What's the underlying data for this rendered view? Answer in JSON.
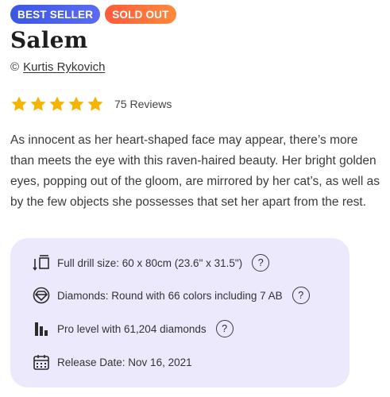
{
  "badges": {
    "best_seller": "BEST SELLER",
    "sold_out": "SOLD OUT"
  },
  "product": {
    "title": "Salem",
    "copyright_symbol": "©",
    "author": "Kurtis Rykovich",
    "rating": 5,
    "reviews_text": "75 Reviews",
    "description": "As innocent as her heart-shaped face may appear, there’s more than meets the eye with this raven-haired beauty. Her bright golden eyes, popping out of the gloom, are mirrored by her cat’s, as well as by the few objects she possesses that set her apart from the rest."
  },
  "details": [
    {
      "icon": "canvas-size-icon",
      "text": "Full drill size: 60 x 80cm (23.6\" x 31.5\")",
      "help": "?"
    },
    {
      "icon": "diamond-icon",
      "text": "Diamonds: Round with 66 colors including 7 AB",
      "help": "?"
    },
    {
      "icon": "level-bars-icon",
      "text": "Pro level with 61,204 diamonds",
      "help": "?"
    },
    {
      "icon": "calendar-icon",
      "text": "Release Date: Nov 16, 2021"
    }
  ],
  "colors": {
    "star": "#f4b400",
    "panel_bg": "#ece9fd",
    "badge_best": "#4a5ef0",
    "badge_sold": "#ff6a3a"
  }
}
